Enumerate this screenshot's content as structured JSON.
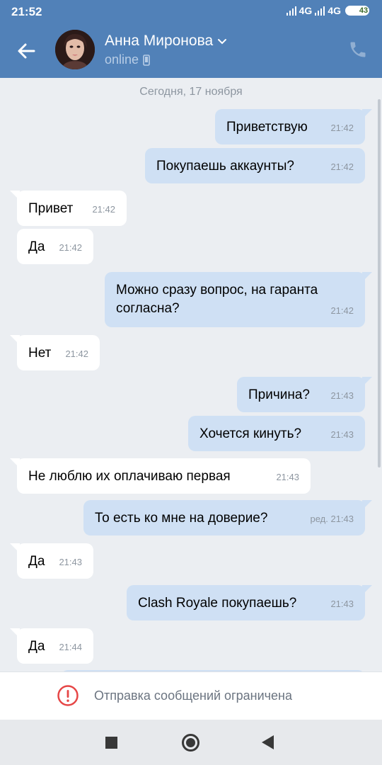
{
  "status_bar": {
    "time": "21:52",
    "network_1": "4G",
    "network_2": "4G",
    "battery": "43"
  },
  "header": {
    "contact_name": "Анна Миронова",
    "presence": "online",
    "icons": [
      "back-arrow-icon",
      "chevron-down-icon",
      "mobile-device-icon",
      "phone-icon"
    ]
  },
  "chat": {
    "date_separator": "Сегодня, 17 ноября",
    "messages": [
      {
        "direction": "out",
        "text": "Приветствую",
        "time": "21:42"
      },
      {
        "direction": "out",
        "text": "Покупаешь аккаунты?",
        "time": "21:42"
      },
      {
        "direction": "in",
        "text": "Привет",
        "time": "21:42"
      },
      {
        "direction": "in",
        "text": "Да",
        "time": "21:42"
      },
      {
        "direction": "out",
        "text": "Можно сразу вопрос, на гаранта согласна?",
        "time": "21:42"
      },
      {
        "direction": "in",
        "text": "Нет",
        "time": "21:42"
      },
      {
        "direction": "out",
        "text": "Причина?",
        "time": "21:43"
      },
      {
        "direction": "out",
        "text": "Хочется кинуть?",
        "time": "21:43"
      },
      {
        "direction": "in",
        "text": "Не люблю их оплачиваю первая",
        "time": "21:43"
      },
      {
        "direction": "out",
        "text": "То есть ко мне на доверие?",
        "time": "ред. 21:43"
      },
      {
        "direction": "in",
        "text": "Да",
        "time": "21:43"
      },
      {
        "direction": "out",
        "text": "Clash Royale покупаешь?",
        "time": "21:43"
      },
      {
        "direction": "in",
        "text": "Да",
        "time": "21:44"
      }
    ]
  },
  "bottom_bar": {
    "restricted_text": "Отправка сообщений ограничена",
    "icon": "exclamation-circle-icon"
  },
  "navbar": {
    "icons": [
      "recent-apps-icon",
      "home-icon",
      "back-icon"
    ]
  },
  "colors": {
    "header_bg": "#5181b8",
    "chat_bg": "#ebeef2",
    "outgoing_bubble": "#cfe0f4",
    "incoming_bubble": "#ffffff",
    "warning_red": "#e64646"
  }
}
